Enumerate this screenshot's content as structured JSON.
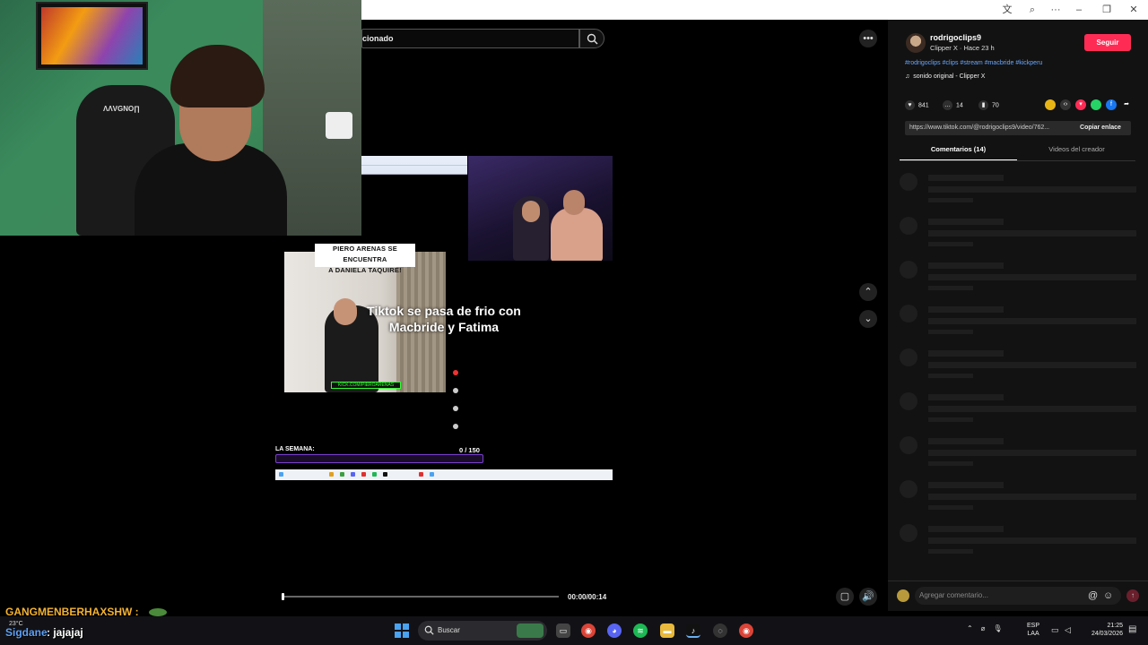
{
  "browser": {
    "titlebar_icons": [
      "translate-icon",
      "zoom-icon",
      "more-icon"
    ],
    "window_controls": [
      "minimize",
      "restore",
      "close"
    ]
  },
  "webcam": {
    "chair_label": "ΛΛVGNO∏"
  },
  "video": {
    "search_text": "cionado",
    "title_card_line1": "PIERO ARENAS SE ENCUENTRA",
    "title_card_line2": "A DANIELA TAQUIRE!",
    "kick_label": "KICK.COM/PIEROARENAS",
    "caption_line1": "Tiktok se pasa de frio con",
    "caption_line2": "Macbride y Fatima",
    "semana_label": "LA SEMANA:",
    "counter": "0  / 150",
    "time": "00:00/00:14",
    "progress_fraction": 0.0
  },
  "creator": {
    "username": "rodrigoclips9",
    "subline": "Clipper X · Hace 23 h",
    "follow_label": "Seguir",
    "hashtags": "#rodrigoclips #clips #stream #macbride #kickperu",
    "sound": "sonido original - Clipper X"
  },
  "stats": {
    "likes": "841",
    "comments": "14",
    "saves": "70"
  },
  "share": {
    "url": "https://www.tiktok.com/@rodrigoclips9/video/762...",
    "copy_label": "Copiar enlace"
  },
  "tabs": {
    "comments": "Comentarios (14)",
    "creator_videos": "Videos del creador"
  },
  "comment_box": {
    "placeholder": "Agregar comentario..."
  },
  "chat": {
    "user": "GANGMENBERHAXSHW :",
    "message": "jajajaj"
  },
  "taskbar": {
    "weather_temp": "23°C",
    "weather_label": "Sigdane",
    "search_label": "Buscar",
    "lang_line1": "ESP",
    "lang_line2": "LAA",
    "time": "21:25",
    "date": "24/03/2026"
  },
  "colors": {
    "follow": "#fe2c55",
    "hashtag": "#6aa7ff",
    "chat_user": "#f2b233"
  }
}
